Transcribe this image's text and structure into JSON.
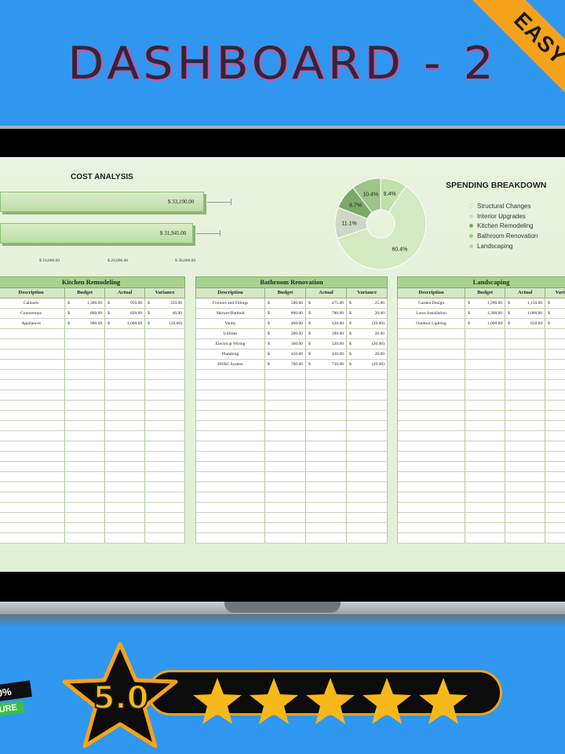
{
  "header": {
    "title": "DASHBOARD - 2",
    "ribbon": "EASY"
  },
  "cost_analysis": {
    "title": "COST ANALYSIS",
    "bars": [
      {
        "label": "$ 33,190.00",
        "value": 33190
      },
      {
        "label": "$ 31,945.00",
        "value": 31945
      }
    ],
    "ticks": [
      "$ 10,000.00",
      "$ 20,000.00",
      "$ 30,000.00"
    ]
  },
  "spending": {
    "title": "SPENDING BREAKDOWN",
    "legend": [
      {
        "label": "Structural Changes",
        "color": "#f0f6ea"
      },
      {
        "label": "Interior Upgrades",
        "color": "#c7dcbc"
      },
      {
        "label": "Kitchen Remodeling",
        "color": "#7da86a"
      },
      {
        "label": "Bathroom Renovation",
        "color": "#9fc48b"
      },
      {
        "label": "Landscaping",
        "color": "#b5d9a0"
      }
    ]
  },
  "chart_data": {
    "type": "pie",
    "title": "SPENDING BREAKDOWN",
    "labels": [
      "Structural Changes",
      "Interior Upgrades",
      "Kitchen Remodeling",
      "Bathroom Renovation",
      "Landscaping"
    ],
    "values": [
      60.4,
      11.1,
      8.7,
      10.4,
      9.4
    ],
    "value_labels": [
      "60.4%",
      "11.1%",
      "8.7%",
      "10.4%",
      "9.4%"
    ],
    "colors": [
      "#d4eac3",
      "#cfd8c6",
      "#7da86a",
      "#9fc48b",
      "#c2e0aa"
    ]
  },
  "tables": [
    {
      "title": "Kitchen Remodeling",
      "columns": [
        "Description",
        "Budget",
        "Actual",
        "Variance"
      ],
      "rows": [
        {
          "desc": "Cabinets",
          "budget": "1,300.00",
          "actual": "950.00",
          "variance": "350.00"
        },
        {
          "desc": "Countertops",
          "budget": "860.00",
          "actual": "820.00",
          "variance": "40.00"
        },
        {
          "desc": "Appliances",
          "budget": "980.00",
          "actual": "1,000.00",
          "variance": "(20.00)"
        }
      ]
    },
    {
      "title": "Bathroom Renovation",
      "columns": [
        "Description",
        "Budget",
        "Actual",
        "Variance"
      ],
      "rows": [
        {
          "desc": "Fixtures and Fittings",
          "budget": "500.00",
          "actual": "475.00",
          "variance": "25.00"
        },
        {
          "desc": "Shower/Bathtub",
          "budget": "800.00",
          "actual": "780.00",
          "variance": "20.00"
        },
        {
          "desc": "Vanity",
          "budget": "400.00",
          "actual": "420.00",
          "variance": "(20.00)"
        },
        {
          "desc": "Utilities",
          "budget": "200.00",
          "actual": "180.00",
          "variance": "20.00"
        },
        {
          "desc": "Electrical Wiring",
          "budget": "300.00",
          "actual": "320.00",
          "variance": "(20.00)"
        },
        {
          "desc": "Plumbing",
          "budget": "450.00",
          "actual": "430.00",
          "variance": "20.00"
        },
        {
          "desc": "HVAC System",
          "budget": "700.00",
          "actual": "720.00",
          "variance": "(20.00)"
        }
      ]
    },
    {
      "title": "Landscaping",
      "columns": [
        "Description",
        "Budget",
        "Actual",
        "Variance"
      ],
      "rows": [
        {
          "desc": "Garden Design",
          "budget": "1,200.00",
          "actual": "1,150.00",
          "variance": ""
        },
        {
          "desc": "Lawn Installation",
          "budget": "1,300.00",
          "actual": "1,000.00",
          "variance": ""
        },
        {
          "desc": "Outdoor Lighting",
          "budget": "1,000.00",
          "actual": "850.00",
          "variance": ""
        }
      ]
    }
  ],
  "currency": "$",
  "rating": {
    "score": "5.0",
    "stars": 5
  },
  "badge": {
    "line1": "0%",
    "line2": "URE"
  }
}
